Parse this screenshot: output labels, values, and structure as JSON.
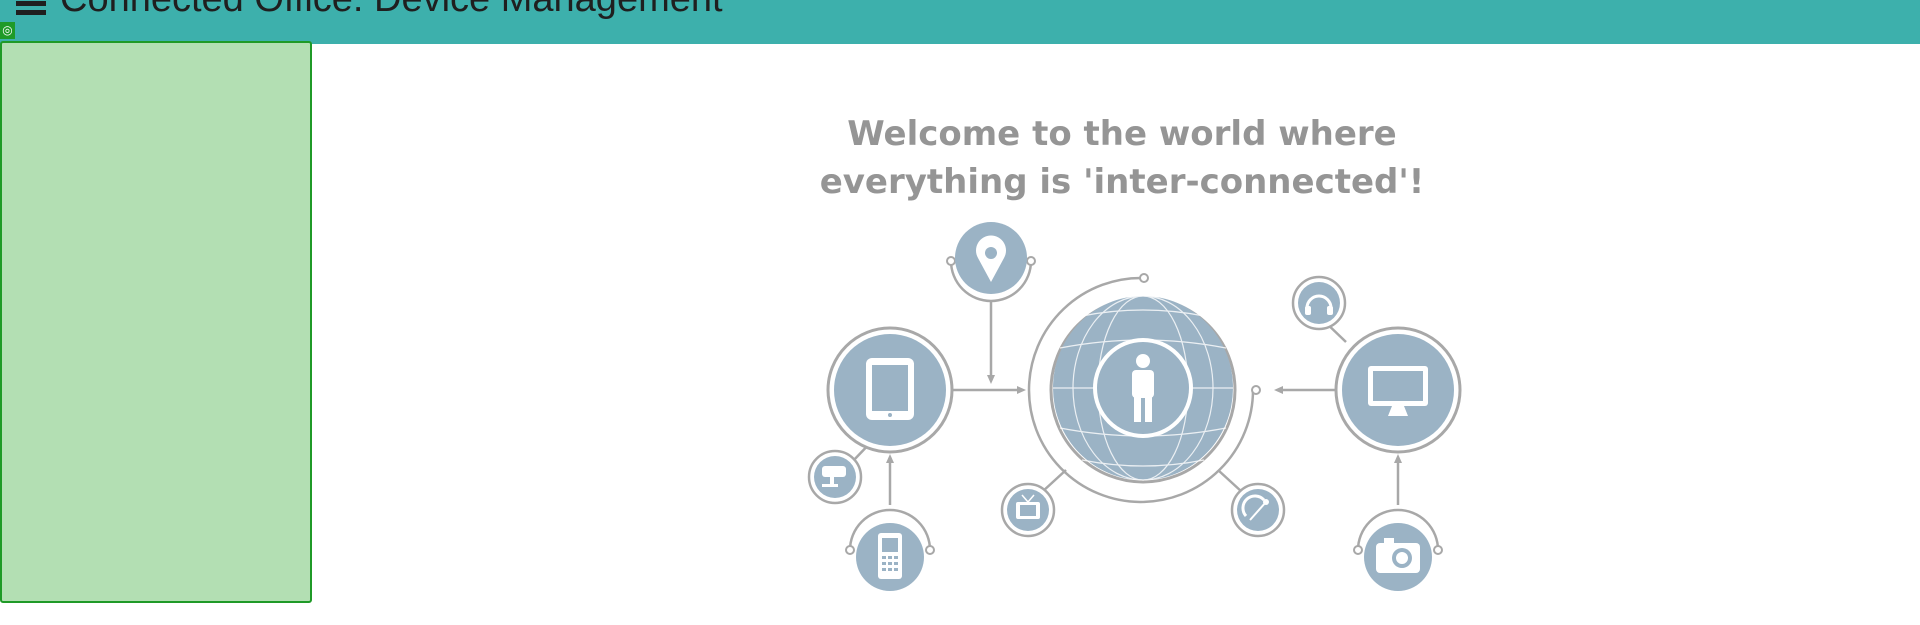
{
  "header": {
    "title": "Connected Office: Device Management",
    "menu_icon": "hamburger-menu-icon"
  },
  "sidebar": {
    "toggle_icon": "target-icon"
  },
  "main": {
    "welcome_line1": "Welcome to the world where",
    "welcome_line2": "everything is 'inter-connected'!"
  },
  "colors": {
    "header_bg": "#3db0ac",
    "sidebar_bg": "#b3dfb3",
    "sidebar_border": "#1f9a27",
    "icon_fill": "#9bb3c5",
    "line_gray": "#a8a8a8",
    "welcome_text": "#959595"
  },
  "illustration": {
    "center": "person-globe-icon",
    "devices": [
      "tablet-icon",
      "location-pin-icon",
      "cctv-camera-icon",
      "mobile-phone-icon",
      "tv-icon",
      "satellite-dish-icon",
      "headphones-icon",
      "desktop-monitor-icon",
      "camera-icon"
    ]
  }
}
